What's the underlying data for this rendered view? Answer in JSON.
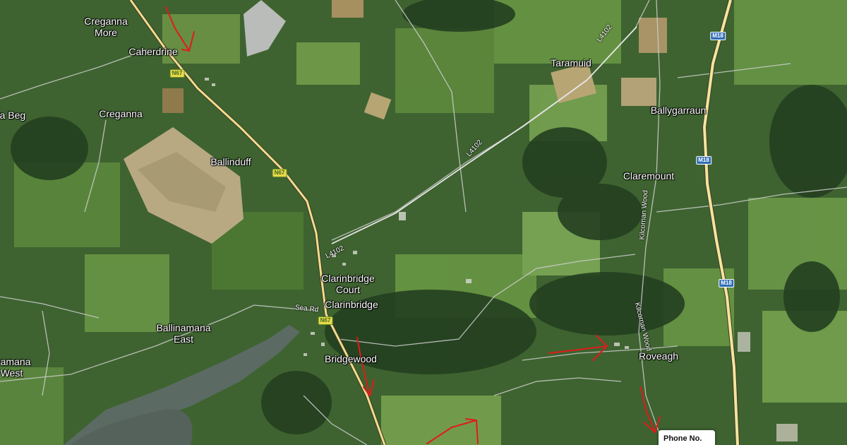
{
  "map": {
    "type": "satellite",
    "places": {
      "creganna_more": "Creganna\nMore",
      "caherdrine": "Caherdrine",
      "na_beg": "na Beg",
      "creganna": "Creganna",
      "ballinduff": "Ballinduff",
      "taramuid": "Taramuid",
      "ballygarraun": "Ballygarraun",
      "claremount": "Claremount",
      "clarinbridge_court": "Clarinbridge\nCourt",
      "clarinbridge": "Clarinbridge",
      "ballinamana_east": "Ballinamana\nEast",
      "amana_west": "amana\nWest",
      "bridgewood": "Bridgewood",
      "roveagh": "Roveagh"
    },
    "road_shields": {
      "n67_a": "N67",
      "n67_b": "N67",
      "n67_c": "N67",
      "m18_a": "M18",
      "m18_b": "M18",
      "m18_c": "M18"
    },
    "road_labels": {
      "l4102_a": "L4102",
      "l4102_b": "L4102",
      "l4102_c": "L4102",
      "sea_rd": "Sea Rd",
      "kilcornan_wood_a": "Kilcornan Wood",
      "kilcornan_wood_b": "Kilcornan Wood"
    },
    "popup": {
      "label": "Phone No."
    },
    "colors": {
      "field_dark": "#2d4a26",
      "field_mid": "#4f7a36",
      "field_light": "#7fa15a",
      "bare": "#b3a77f",
      "water": "#5a6b66",
      "road_major": "#f1dc8a",
      "road_minor": "#c8c8c8",
      "annotation_arrow": "#e01b1b"
    }
  }
}
